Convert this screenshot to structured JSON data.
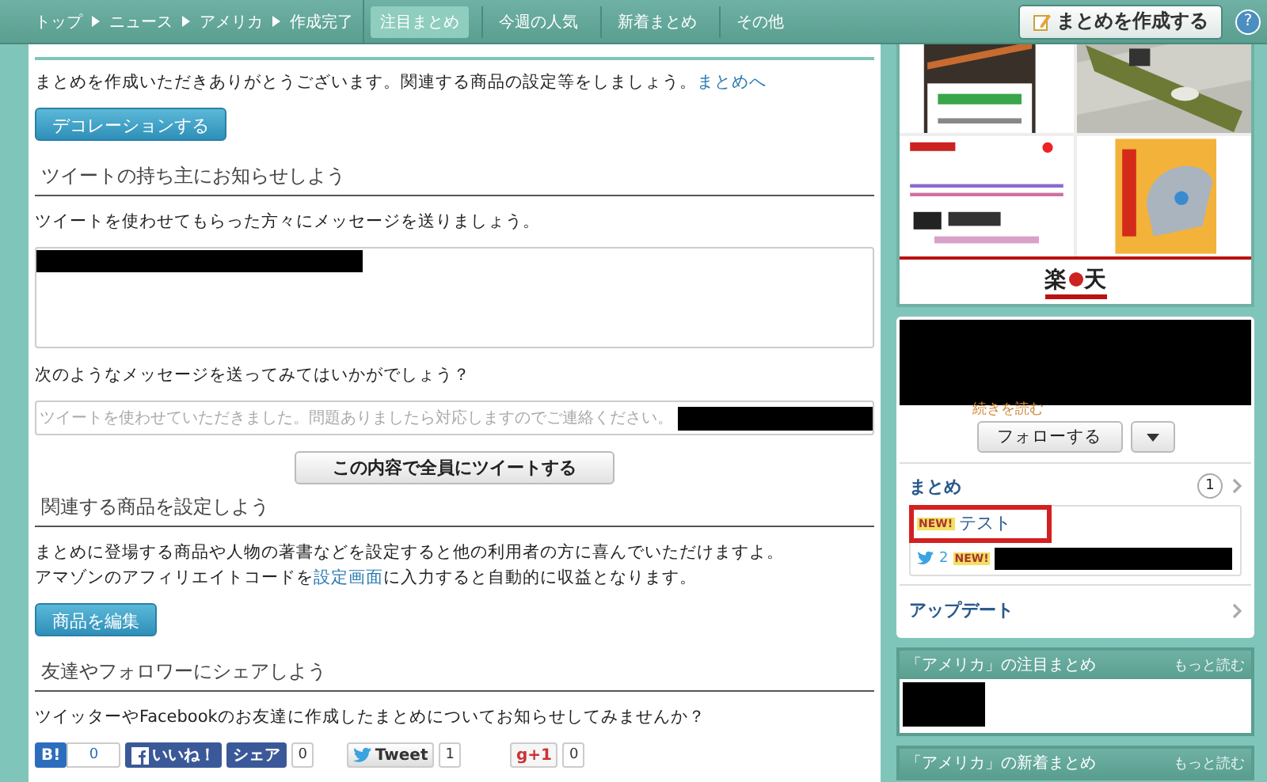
{
  "nav": {
    "breadcrumbs": [
      "トップ",
      "ニュース",
      "アメリカ",
      "作成完了"
    ],
    "tabs": [
      {
        "label": "注目まとめ",
        "selected": true
      },
      {
        "label": "今週の人気",
        "selected": false
      },
      {
        "label": "新着まとめ",
        "selected": false
      },
      {
        "label": "その他",
        "selected": false
      }
    ],
    "create_button": "まとめを作成する",
    "help": "?"
  },
  "main": {
    "intro": {
      "text": "まとめを作成いただきありがとうございます。関連する商品の設定等をしましょう。",
      "link": "まとめへ"
    },
    "decorate_button": "デコレーションする",
    "sections": [
      {
        "kind": "tweet",
        "heading": "ツイートの持ち主にお知らせしよう",
        "text": "ツイートを使わせてもらった方々にメッセージを送りましょう。",
        "suggest_label": "次のようなメッセージを送ってみてはいかがでしょう？",
        "suggest_value": "ツイートを使わせていただきました。問題ありましたら対応しますのでご連絡ください。",
        "button": "この内容で全員にツイートする"
      },
      {
        "kind": "products",
        "heading": "関連する商品を設定しよう",
        "line1": "まとめに登場する商品や人物の著書などを設定すると他の利用者の方に喜んでいただけますよ。",
        "line2_before": "アマゾンのアフィリエイトコードを",
        "line2_link": "設定画面",
        "line2_after": "に入力すると自動的に収益となります。",
        "button": "商品を編集"
      },
      {
        "kind": "share",
        "heading": "友達やフォロワーにシェアしよう",
        "text": "ツイッターやFacebookのお友達に作成したまとめについてお知らせしてみませんか？"
      }
    ],
    "share_buttons": [
      {
        "kind": "hatena",
        "label": "B!",
        "count": "0"
      },
      {
        "kind": "facebook",
        "label": "いいね！"
      },
      {
        "kind": "share",
        "label": "シェア",
        "count": "0"
      },
      {
        "kind": "tweet",
        "label": "Tweet",
        "count": "1"
      },
      {
        "kind": "gplus",
        "label": "g+1",
        "count": "0"
      }
    ]
  },
  "sidebar": {
    "ad_logo": "楽天",
    "profile": {
      "read_more": "続きを読む",
      "follow_button": "フォローする",
      "matome": {
        "title": "まとめ",
        "count": "1",
        "items": [
          {
            "badge": "NEW!",
            "title": "テスト",
            "highlighted": true
          },
          {
            "badge": "NEW!",
            "highlighted": false,
            "tweets": "2"
          }
        ]
      },
      "update": "アップデート"
    },
    "panels": [
      {
        "title": "「アメリカ」の注目まとめ",
        "more": "もっと読む"
      },
      {
        "title": "「アメリカ」の新着まとめ",
        "more": "もっと読む"
      }
    ]
  }
}
